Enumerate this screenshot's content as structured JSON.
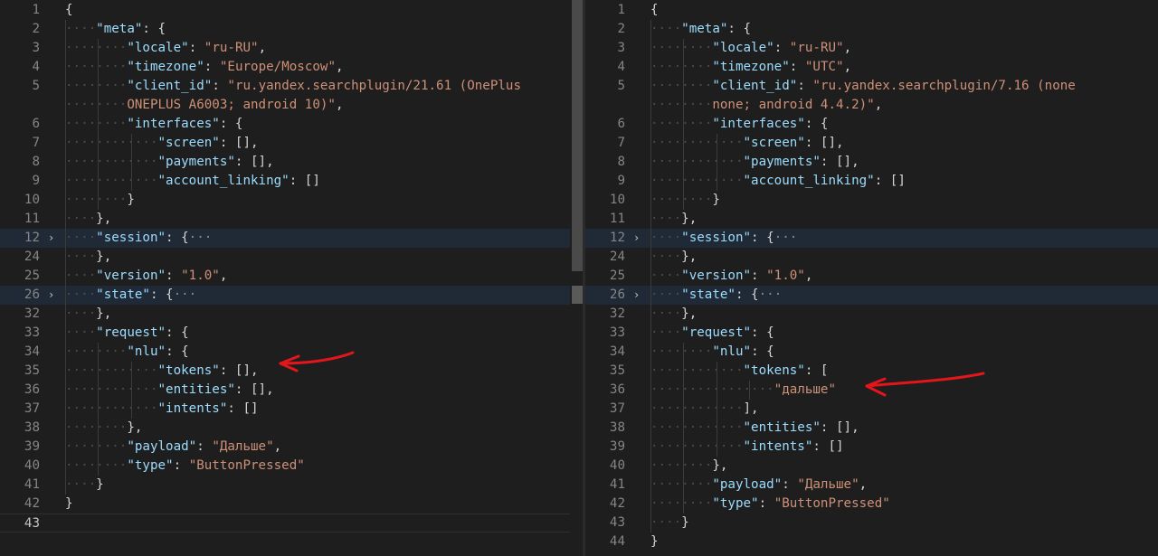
{
  "left_editor": {
    "lines": [
      {
        "n": "1",
        "ind": 0,
        "t": [
          [
            "p",
            "{"
          ]
        ]
      },
      {
        "n": "2",
        "ind": 1,
        "t": [
          [
            "k",
            "\"meta\""
          ],
          [
            "p",
            ": {"
          ]
        ]
      },
      {
        "n": "3",
        "ind": 2,
        "t": [
          [
            "k",
            "\"locale\""
          ],
          [
            "p",
            ": "
          ],
          [
            "s",
            "\"ru-RU\""
          ],
          [
            "p",
            ","
          ]
        ]
      },
      {
        "n": "4",
        "ind": 2,
        "t": [
          [
            "k",
            "\"timezone\""
          ],
          [
            "p",
            ": "
          ],
          [
            "s",
            "\"Europe/Moscow\""
          ],
          [
            "p",
            ","
          ]
        ]
      },
      {
        "n": "5",
        "ind": 2,
        "t": [
          [
            "k",
            "\"client_id\""
          ],
          [
            "p",
            ": "
          ],
          [
            "s",
            "\"ru.yandex.searchplugin/21.61 (OnePlus"
          ]
        ]
      },
      {
        "n": "",
        "ind": 2,
        "t": [
          [
            "s",
            "ONEPLUS A6003; android 10)\""
          ],
          [
            "p",
            ","
          ]
        ]
      },
      {
        "n": "6",
        "ind": 2,
        "t": [
          [
            "k",
            "\"interfaces\""
          ],
          [
            "p",
            ": {"
          ]
        ]
      },
      {
        "n": "7",
        "ind": 3,
        "t": [
          [
            "k",
            "\"screen\""
          ],
          [
            "p",
            ": [],"
          ]
        ]
      },
      {
        "n": "8",
        "ind": 3,
        "t": [
          [
            "k",
            "\"payments\""
          ],
          [
            "p",
            ": [],"
          ]
        ]
      },
      {
        "n": "9",
        "ind": 3,
        "t": [
          [
            "k",
            "\"account_linking\""
          ],
          [
            "p",
            ": []"
          ]
        ]
      },
      {
        "n": "10",
        "ind": 2,
        "t": [
          [
            "p",
            "}"
          ]
        ]
      },
      {
        "n": "11",
        "ind": 1,
        "t": [
          [
            "p",
            "},"
          ]
        ]
      },
      {
        "n": "12",
        "ind": 1,
        "fold": true,
        "hl": true,
        "t": [
          [
            "k",
            "\"session\""
          ],
          [
            "p",
            ": {"
          ],
          [
            "el",
            "···"
          ]
        ]
      },
      {
        "n": "24",
        "ind": 1,
        "t": [
          [
            "p",
            "},"
          ]
        ]
      },
      {
        "n": "25",
        "ind": 1,
        "t": [
          [
            "k",
            "\"version\""
          ],
          [
            "p",
            ": "
          ],
          [
            "s",
            "\"1.0\""
          ],
          [
            "p",
            ","
          ]
        ]
      },
      {
        "n": "26",
        "ind": 1,
        "fold": true,
        "hl": true,
        "t": [
          [
            "k",
            "\"state\""
          ],
          [
            "p",
            ": {"
          ],
          [
            "el",
            "···"
          ]
        ]
      },
      {
        "n": "32",
        "ind": 1,
        "t": [
          [
            "p",
            "},"
          ]
        ]
      },
      {
        "n": "33",
        "ind": 1,
        "t": [
          [
            "k",
            "\"request\""
          ],
          [
            "p",
            ": {"
          ]
        ]
      },
      {
        "n": "34",
        "ind": 2,
        "t": [
          [
            "k",
            "\"nlu\""
          ],
          [
            "p",
            ": {"
          ]
        ]
      },
      {
        "n": "35",
        "ind": 3,
        "t": [
          [
            "k",
            "\"tokens\""
          ],
          [
            "p",
            ": [],"
          ]
        ]
      },
      {
        "n": "36",
        "ind": 3,
        "t": [
          [
            "k",
            "\"entities\""
          ],
          [
            "p",
            ": [],"
          ]
        ]
      },
      {
        "n": "37",
        "ind": 3,
        "t": [
          [
            "k",
            "\"intents\""
          ],
          [
            "p",
            ": []"
          ]
        ]
      },
      {
        "n": "38",
        "ind": 2,
        "t": [
          [
            "p",
            "},"
          ]
        ]
      },
      {
        "n": "39",
        "ind": 2,
        "t": [
          [
            "k",
            "\"payload\""
          ],
          [
            "p",
            ": "
          ],
          [
            "s",
            "\"Дальше\""
          ],
          [
            "p",
            ","
          ]
        ]
      },
      {
        "n": "40",
        "ind": 2,
        "t": [
          [
            "k",
            "\"type\""
          ],
          [
            "p",
            ": "
          ],
          [
            "s",
            "\"ButtonPressed\""
          ]
        ]
      },
      {
        "n": "41",
        "ind": 1,
        "t": [
          [
            "p",
            "}"
          ]
        ]
      },
      {
        "n": "42",
        "ind": 0,
        "t": [
          [
            "p",
            "}"
          ]
        ]
      },
      {
        "n": "43",
        "ind": 0,
        "cur": true,
        "t": []
      }
    ]
  },
  "right_editor": {
    "lines": [
      {
        "n": "1",
        "ind": 0,
        "t": [
          [
            "p",
            "{"
          ]
        ]
      },
      {
        "n": "2",
        "ind": 1,
        "t": [
          [
            "k",
            "\"meta\""
          ],
          [
            "p",
            ": {"
          ]
        ]
      },
      {
        "n": "3",
        "ind": 2,
        "t": [
          [
            "k",
            "\"locale\""
          ],
          [
            "p",
            ": "
          ],
          [
            "s",
            "\"ru-RU\""
          ],
          [
            "p",
            ","
          ]
        ]
      },
      {
        "n": "4",
        "ind": 2,
        "t": [
          [
            "k",
            "\"timezone\""
          ],
          [
            "p",
            ": "
          ],
          [
            "s",
            "\"UTC\""
          ],
          [
            "p",
            ","
          ]
        ]
      },
      {
        "n": "5",
        "ind": 2,
        "t": [
          [
            "k",
            "\"client_id\""
          ],
          [
            "p",
            ": "
          ],
          [
            "s",
            "\"ru.yandex.searchplugin/7.16 (none"
          ]
        ]
      },
      {
        "n": "",
        "ind": 2,
        "t": [
          [
            "s",
            "none; android 4.4.2)\""
          ],
          [
            "p",
            ","
          ]
        ]
      },
      {
        "n": "6",
        "ind": 2,
        "t": [
          [
            "k",
            "\"interfaces\""
          ],
          [
            "p",
            ": {"
          ]
        ]
      },
      {
        "n": "7",
        "ind": 3,
        "t": [
          [
            "k",
            "\"screen\""
          ],
          [
            "p",
            ": [],"
          ]
        ]
      },
      {
        "n": "8",
        "ind": 3,
        "t": [
          [
            "k",
            "\"payments\""
          ],
          [
            "p",
            ": [],"
          ]
        ]
      },
      {
        "n": "9",
        "ind": 3,
        "t": [
          [
            "k",
            "\"account_linking\""
          ],
          [
            "p",
            ": []"
          ]
        ]
      },
      {
        "n": "10",
        "ind": 2,
        "t": [
          [
            "p",
            "}"
          ]
        ]
      },
      {
        "n": "11",
        "ind": 1,
        "t": [
          [
            "p",
            "},"
          ]
        ]
      },
      {
        "n": "12",
        "ind": 1,
        "fold": true,
        "hl": true,
        "t": [
          [
            "k",
            "\"session\""
          ],
          [
            "p",
            ": {"
          ],
          [
            "el",
            "···"
          ]
        ]
      },
      {
        "n": "24",
        "ind": 1,
        "t": [
          [
            "p",
            "},"
          ]
        ]
      },
      {
        "n": "25",
        "ind": 1,
        "t": [
          [
            "k",
            "\"version\""
          ],
          [
            "p",
            ": "
          ],
          [
            "s",
            "\"1.0\""
          ],
          [
            "p",
            ","
          ]
        ]
      },
      {
        "n": "26",
        "ind": 1,
        "fold": true,
        "hl": true,
        "t": [
          [
            "k",
            "\"state\""
          ],
          [
            "p",
            ": {"
          ],
          [
            "el",
            "···"
          ]
        ]
      },
      {
        "n": "32",
        "ind": 1,
        "t": [
          [
            "p",
            "},"
          ]
        ]
      },
      {
        "n": "33",
        "ind": 1,
        "t": [
          [
            "k",
            "\"request\""
          ],
          [
            "p",
            ": {"
          ]
        ]
      },
      {
        "n": "34",
        "ind": 2,
        "t": [
          [
            "k",
            "\"nlu\""
          ],
          [
            "p",
            ": {"
          ]
        ]
      },
      {
        "n": "35",
        "ind": 3,
        "t": [
          [
            "k",
            "\"tokens\""
          ],
          [
            "p",
            ": ["
          ]
        ]
      },
      {
        "n": "36",
        "ind": 4,
        "t": [
          [
            "s",
            "\"дальше\""
          ]
        ]
      },
      {
        "n": "37",
        "ind": 3,
        "t": [
          [
            "p",
            "],"
          ]
        ]
      },
      {
        "n": "38",
        "ind": 3,
        "t": [
          [
            "k",
            "\"entities\""
          ],
          [
            "p",
            ": [],"
          ]
        ]
      },
      {
        "n": "39",
        "ind": 3,
        "t": [
          [
            "k",
            "\"intents\""
          ],
          [
            "p",
            ": []"
          ]
        ]
      },
      {
        "n": "40",
        "ind": 2,
        "t": [
          [
            "p",
            "},"
          ]
        ]
      },
      {
        "n": "41",
        "ind": 2,
        "t": [
          [
            "k",
            "\"payload\""
          ],
          [
            "p",
            ": "
          ],
          [
            "s",
            "\"Дальше\""
          ],
          [
            "p",
            ","
          ]
        ]
      },
      {
        "n": "42",
        "ind": 2,
        "t": [
          [
            "k",
            "\"type\""
          ],
          [
            "p",
            ": "
          ],
          [
            "s",
            "\"ButtonPressed\""
          ]
        ]
      },
      {
        "n": "43",
        "ind": 1,
        "t": [
          [
            "p",
            "}"
          ]
        ]
      },
      {
        "n": "44",
        "ind": 0,
        "t": [
          [
            "p",
            "}"
          ]
        ]
      }
    ]
  }
}
